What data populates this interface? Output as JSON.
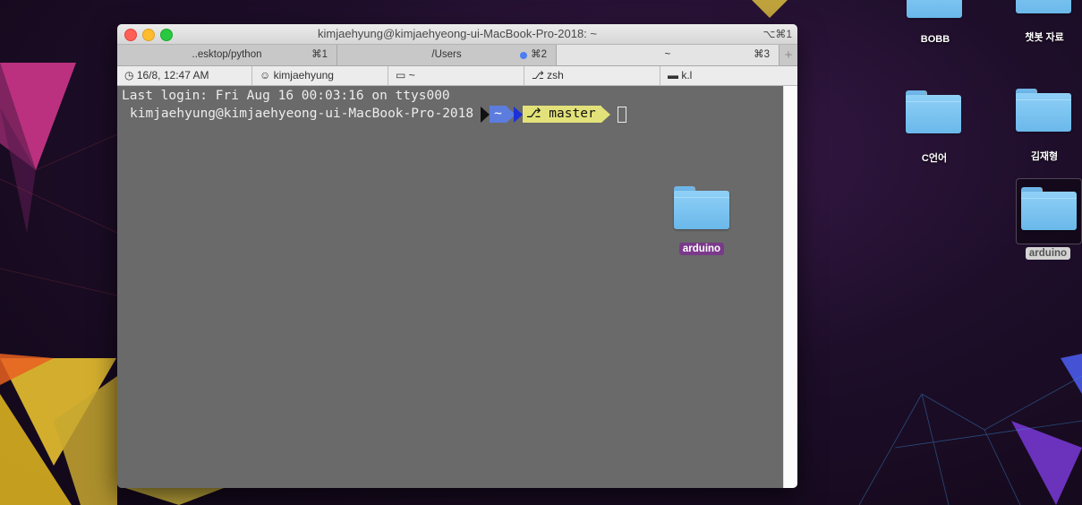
{
  "window": {
    "title": "kimjaehyung@kimjaehyeong-ui-MacBook-Pro-2018: ~",
    "shortcut": "⌥⌘1",
    "tabs": [
      {
        "label": "..esktop/python",
        "key": "⌘1"
      },
      {
        "label": "/Users",
        "key": "⌘2"
      },
      {
        "label": "~",
        "key": "⌘3"
      }
    ],
    "new_tab": "+"
  },
  "status_bar": {
    "time": "16/8, 12:47 AM",
    "user": "kimjaehyung",
    "dir": "~",
    "shell": "zsh",
    "host": "k.l"
  },
  "terminal": {
    "last_login": "Last login: Fri Aug 16 00:03:16 on ttys000",
    "prompt_user": "kimjaehyung@kimjaehyeong-ui-MacBook-Pro-2018",
    "prompt_dir": "~",
    "prompt_branch": "master"
  },
  "desktop": {
    "dragged_icon_label": "arduino",
    "icons": [
      {
        "label": "BOBB"
      },
      {
        "label": "챗봇 자료"
      },
      {
        "label": "C언어"
      },
      {
        "label": "김재형"
      },
      {
        "label": "arduino"
      }
    ]
  },
  "colors": {
    "traffic_close": "#fe5f57",
    "traffic_min": "#febc2e",
    "traffic_max": "#28c840",
    "powerline_dir": "#5c7cde",
    "powerline_git": "#e3e27a",
    "tag_purple": "#7a3a8a",
    "unsaved_dot": "#4a7ef2"
  }
}
